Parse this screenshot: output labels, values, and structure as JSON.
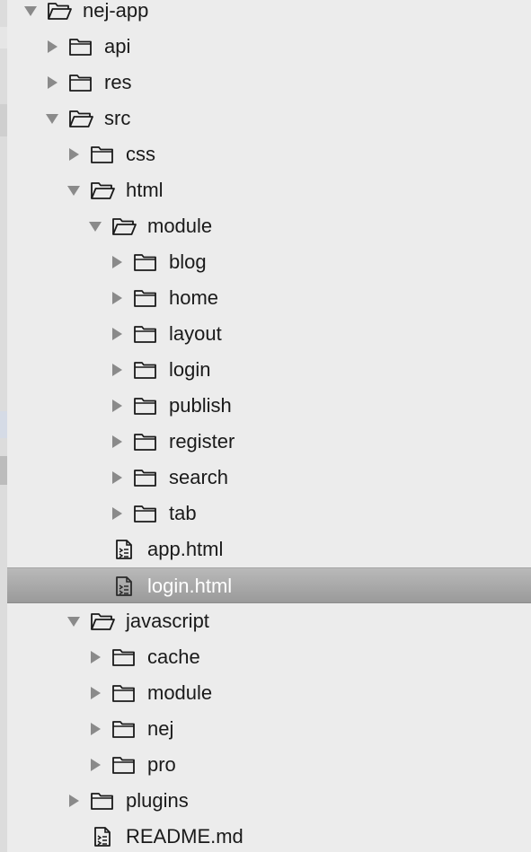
{
  "tree": {
    "rows": [
      {
        "label": "nej-app",
        "depth": 0,
        "kind": "folder",
        "expanded": true
      },
      {
        "label": "api",
        "depth": 1,
        "kind": "folder",
        "expanded": false
      },
      {
        "label": "res",
        "depth": 1,
        "kind": "folder",
        "expanded": false
      },
      {
        "label": "src",
        "depth": 1,
        "kind": "folder",
        "expanded": true
      },
      {
        "label": "css",
        "depth": 2,
        "kind": "folder",
        "expanded": false
      },
      {
        "label": "html",
        "depth": 2,
        "kind": "folder",
        "expanded": true
      },
      {
        "label": "module",
        "depth": 3,
        "kind": "folder",
        "expanded": true
      },
      {
        "label": "blog",
        "depth": 4,
        "kind": "folder",
        "expanded": false
      },
      {
        "label": "home",
        "depth": 4,
        "kind": "folder",
        "expanded": false
      },
      {
        "label": "layout",
        "depth": 4,
        "kind": "folder",
        "expanded": false
      },
      {
        "label": "login",
        "depth": 4,
        "kind": "folder",
        "expanded": false
      },
      {
        "label": "publish",
        "depth": 4,
        "kind": "folder",
        "expanded": false
      },
      {
        "label": "register",
        "depth": 4,
        "kind": "folder",
        "expanded": false
      },
      {
        "label": "search",
        "depth": 4,
        "kind": "folder",
        "expanded": false
      },
      {
        "label": "tab",
        "depth": 4,
        "kind": "folder",
        "expanded": false
      },
      {
        "label": "app.html",
        "depth": 3,
        "kind": "file"
      },
      {
        "label": "login.html",
        "depth": 3,
        "kind": "file",
        "selected": true
      },
      {
        "label": "javascript",
        "depth": 2,
        "kind": "folder",
        "expanded": true
      },
      {
        "label": "cache",
        "depth": 3,
        "kind": "folder",
        "expanded": false
      },
      {
        "label": "module",
        "depth": 3,
        "kind": "folder",
        "expanded": false
      },
      {
        "label": "nej",
        "depth": 3,
        "kind": "folder",
        "expanded": false
      },
      {
        "label": "pro",
        "depth": 3,
        "kind": "folder",
        "expanded": false
      },
      {
        "label": "plugins",
        "depth": 2,
        "kind": "folder",
        "expanded": false
      },
      {
        "label": "README.md",
        "depth": 2,
        "kind": "file"
      }
    ]
  },
  "icons": {
    "folder": "folder-icon",
    "folder_open": "folder-open-icon",
    "file": "file-icon",
    "expanded": "triangle-down-icon",
    "collapsed": "triangle-right-icon"
  },
  "colors": {
    "text": "#1a1a1a",
    "selected_text": "#ffffff",
    "icon_stroke": "#1a1a1a",
    "arrow": "#8a8a8a",
    "selected_icon": "#2a2a2a"
  }
}
